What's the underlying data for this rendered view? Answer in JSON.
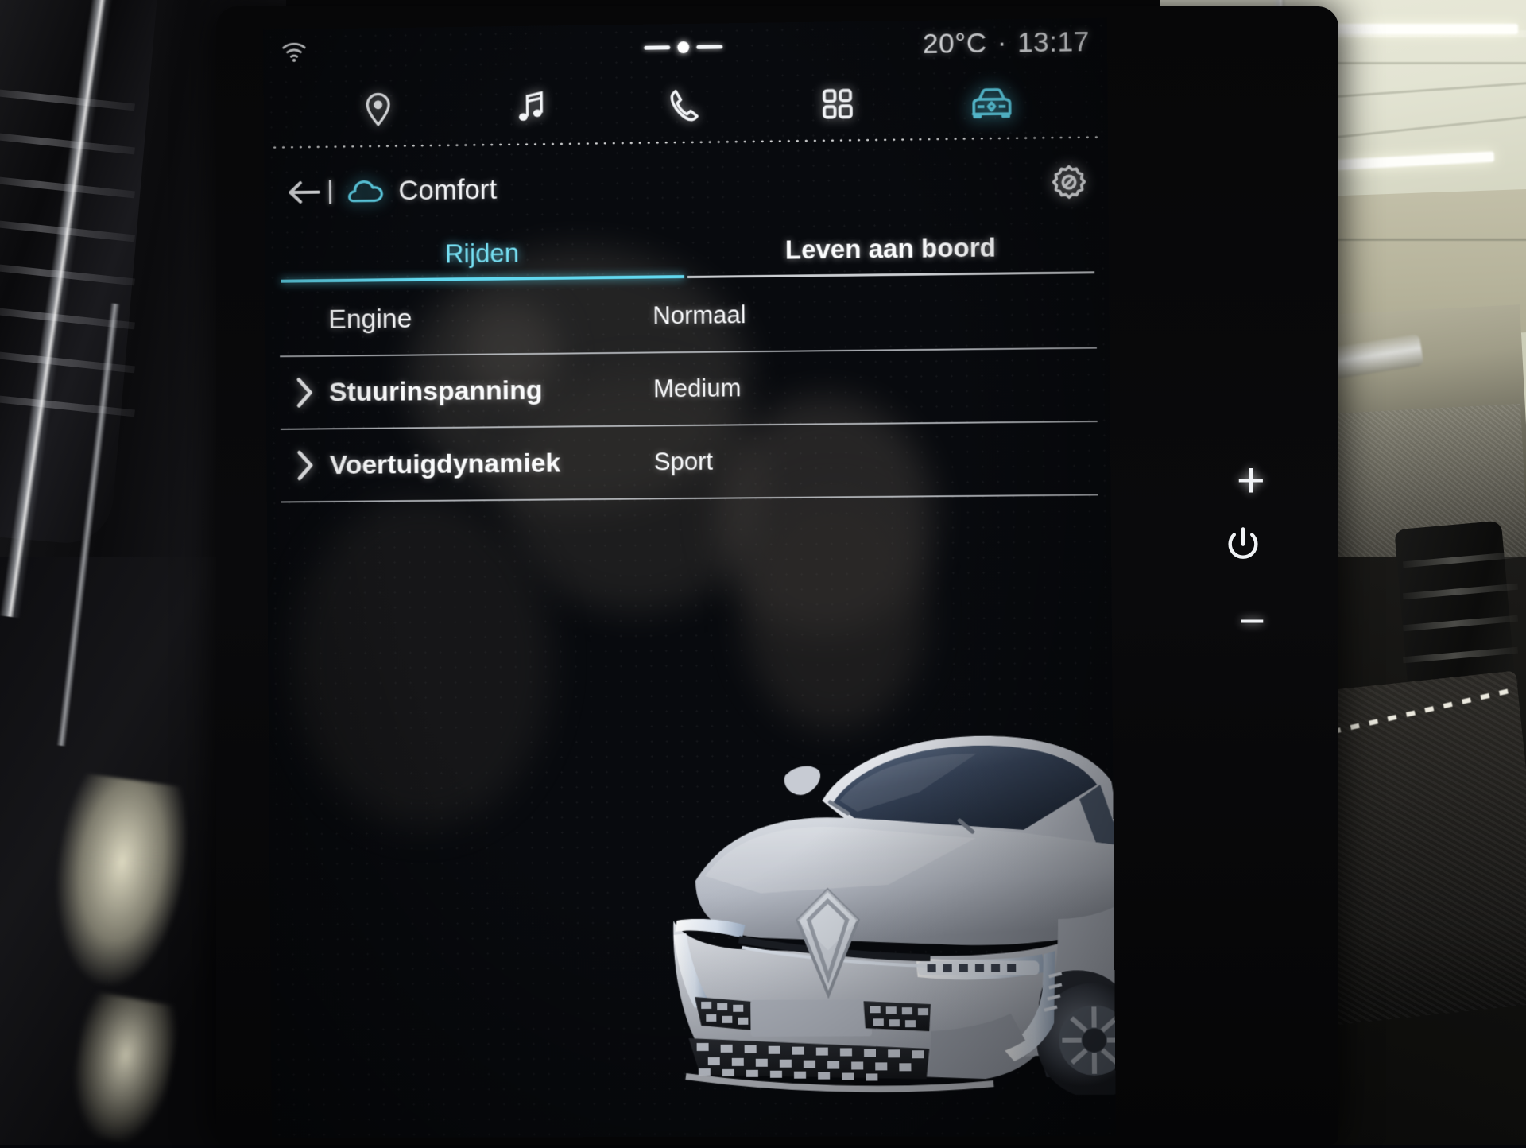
{
  "status": {
    "wifi_icon": "wifi-icon",
    "temperature": "20°C",
    "separator": "·",
    "time": "13:17"
  },
  "navbar": {
    "items": [
      {
        "icon": "location-pin-icon",
        "name": "navigation",
        "active": false
      },
      {
        "icon": "music-note-icon",
        "name": "media",
        "active": false
      },
      {
        "icon": "phone-icon",
        "name": "phone",
        "active": false
      },
      {
        "icon": "grid-apps-icon",
        "name": "apps",
        "active": false
      },
      {
        "icon": "car-front-icon",
        "name": "vehicle",
        "active": true
      }
    ],
    "active_color": "#62d9f0"
  },
  "header": {
    "back_icon": "back-arrow-icon",
    "profile_icon": "cloud-icon",
    "title": "Comfort",
    "settings_icon": "gear-icon"
  },
  "tabs": [
    {
      "label": "Rijden",
      "active": true
    },
    {
      "label": "Leven aan boord",
      "active": false
    }
  ],
  "settings_rows": [
    {
      "label": "Engine",
      "value": "Normaal",
      "chevron": false,
      "bold": false
    },
    {
      "label": "Stuurinspanning",
      "value": "Medium",
      "chevron": true,
      "bold": true
    },
    {
      "label": "Voertuigdynamiek",
      "value": "Sport",
      "chevron": true,
      "bold": true
    }
  ],
  "vehicle_image": {
    "name": "renault-megane-front-render",
    "brand_logo": "renault-diamond-logo",
    "body_color": "#c9ccd4"
  },
  "bezel_buttons": [
    {
      "name": "volume-up-button",
      "glyph": "+"
    },
    {
      "name": "power-button",
      "glyph": "power-icon"
    },
    {
      "name": "volume-down-button",
      "glyph": "−"
    }
  ],
  "colors": {
    "accent_cyan": "#62d9f0",
    "text_primary": "#fafbfc",
    "screen_bg": "#080a0e"
  }
}
